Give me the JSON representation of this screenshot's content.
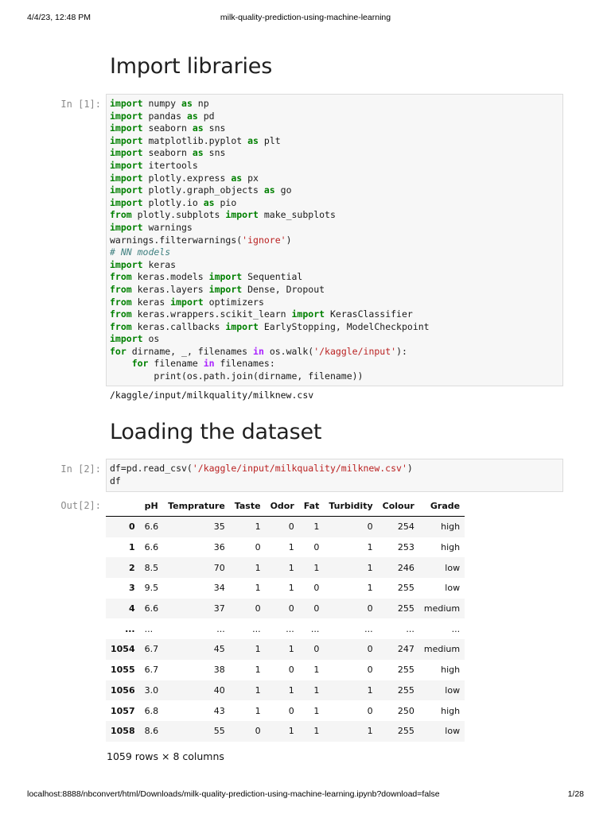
{
  "header": {
    "datetime": "4/4/23, 12:48 PM",
    "doc_title": "milk-quality-prediction-using-machine-learning"
  },
  "footer": {
    "url": "localhost:8888/nbconvert/html/Downloads/milk-quality-prediction-using-machine-learning.ipynb?download=false",
    "page": "1/28"
  },
  "sections": {
    "import_libraries": "Import libraries",
    "loading_dataset": "Loading the dataset"
  },
  "cell1": {
    "prompt": "In [1]:",
    "output": "/kaggle/input/milkquality/milknew.csv"
  },
  "cell2": {
    "prompt": "In [2]:",
    "out_prompt": "Out[2]:"
  },
  "dataframe": {
    "columns": [
      "",
      "pH",
      "Temprature",
      "Taste",
      "Odor",
      "Fat",
      "Turbidity",
      "Colour",
      "Grade"
    ],
    "rows": [
      [
        "0",
        "6.6",
        "35",
        "1",
        "0",
        "1",
        "0",
        "254",
        "high"
      ],
      [
        "1",
        "6.6",
        "36",
        "0",
        "1",
        "0",
        "1",
        "253",
        "high"
      ],
      [
        "2",
        "8.5",
        "70",
        "1",
        "1",
        "1",
        "1",
        "246",
        "low"
      ],
      [
        "3",
        "9.5",
        "34",
        "1",
        "1",
        "0",
        "1",
        "255",
        "low"
      ],
      [
        "4",
        "6.6",
        "37",
        "0",
        "0",
        "0",
        "0",
        "255",
        "medium"
      ],
      [
        "...",
        "...",
        "...",
        "...",
        "...",
        "...",
        "...",
        "...",
        "..."
      ],
      [
        "1054",
        "6.7",
        "45",
        "1",
        "1",
        "0",
        "0",
        "247",
        "medium"
      ],
      [
        "1055",
        "6.7",
        "38",
        "1",
        "0",
        "1",
        "0",
        "255",
        "high"
      ],
      [
        "1056",
        "3.0",
        "40",
        "1",
        "1",
        "1",
        "1",
        "255",
        "low"
      ],
      [
        "1057",
        "6.8",
        "43",
        "1",
        "0",
        "1",
        "0",
        "250",
        "high"
      ],
      [
        "1058",
        "8.6",
        "55",
        "0",
        "1",
        "1",
        "1",
        "255",
        "low"
      ]
    ],
    "shape_text": "1059 rows × 8 columns"
  }
}
